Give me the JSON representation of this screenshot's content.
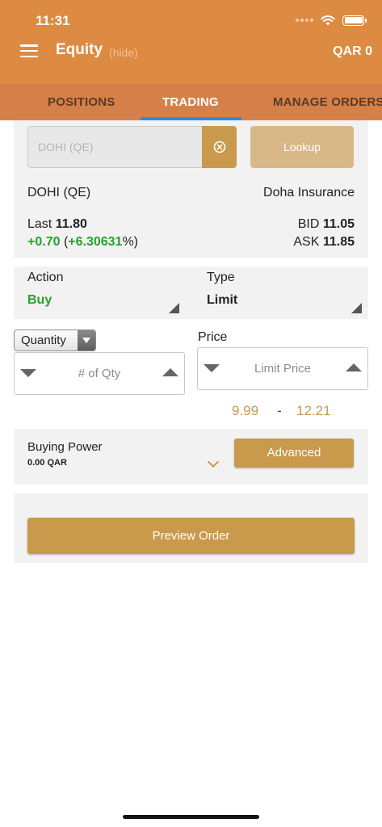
{
  "status_bar": {
    "time": "11:31"
  },
  "header": {
    "title": "Equity",
    "hide_label": "(hide)",
    "balance": "QAR 0"
  },
  "tabs": [
    {
      "label": "POSITIONS"
    },
    {
      "label": "TRADING"
    },
    {
      "label": "MANAGE ORDERS"
    }
  ],
  "symbol_search": {
    "placeholder": "DOHI (QE)",
    "lookup_label": "Lookup"
  },
  "quote": {
    "symbol": "DOHI (QE)",
    "company": "Doha Insurance",
    "last_label": "Last",
    "last_value": "11.80",
    "change": "+0.70",
    "change_pct_open": "(",
    "change_pct": "+6.30631",
    "change_pct_close": "%)",
    "bid_label": "BID",
    "bid_value": "11.05",
    "ask_label": "ASK",
    "ask_value": "11.85"
  },
  "order": {
    "action_label": "Action",
    "action_value": "Buy",
    "type_label": "Type",
    "type_value": "Limit",
    "quantity_mode": "Quantity",
    "quantity_placeholder": "# of Qty",
    "price_label": "Price",
    "price_placeholder": "Limit Price",
    "price_range_low": "9.99",
    "price_range_sep": "-",
    "price_range_high": "12.21"
  },
  "buying_power": {
    "label": "Buying Power",
    "value": "0.00 QAR",
    "advanced_label": "Advanced"
  },
  "preview": {
    "label": "Preview Order"
  },
  "colors": {
    "header": "#dd8a42",
    "tab_bar": "#d68049",
    "accent_gold": "#c9994c",
    "positive": "#26a12a",
    "tab_indicator": "#2f8bdc"
  }
}
